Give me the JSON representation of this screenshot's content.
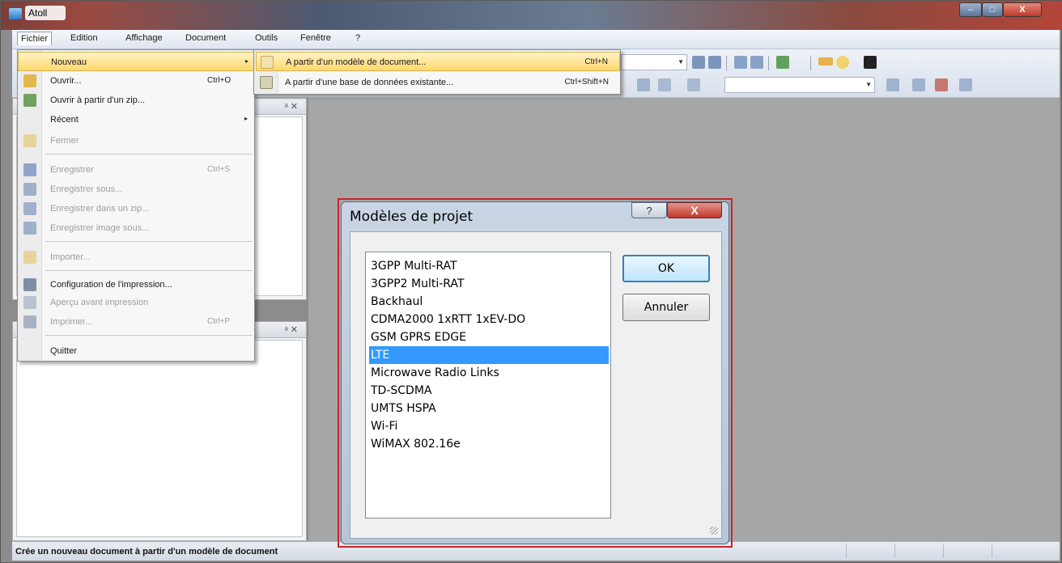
{
  "window": {
    "title": "Atoll",
    "controls": {
      "minimize": "–",
      "maximize": "□",
      "close": "X"
    }
  },
  "menubar": {
    "items": [
      "Fichier",
      "Edition",
      "Affichage",
      "Document",
      "Outils",
      "Fenêtre",
      "?"
    ]
  },
  "file_menu": {
    "items": [
      {
        "label": "Nouveau",
        "shortcut": "",
        "submenu": "▸",
        "icon": "new-document-icon"
      },
      {
        "label": "Ouvrir...",
        "shortcut": "Ctrl+O",
        "icon": "open-folder-icon"
      },
      {
        "label": "Ouvrir à partir d'un zip...",
        "shortcut": "",
        "icon": "open-zip-icon"
      },
      {
        "label": "Récent",
        "shortcut": "",
        "submenu": "▸",
        "icon": ""
      },
      {
        "label": "Fermer",
        "shortcut": "",
        "icon": "close-document-icon"
      },
      {
        "label": "Enregistrer",
        "shortcut": "Ctrl+S",
        "icon": "save-icon"
      },
      {
        "label": "Enregistrer sous...",
        "shortcut": "",
        "icon": "save-as-icon"
      },
      {
        "label": "Enregistrer dans un zip...",
        "shortcut": "",
        "icon": "save-zip-icon"
      },
      {
        "label": "Enregistrer image sous...",
        "shortcut": "",
        "icon": "save-image-icon"
      },
      {
        "label": "Importer...",
        "shortcut": "",
        "icon": "import-icon"
      },
      {
        "label": "Configuration de l'impression...",
        "shortcut": "",
        "icon": "print-setup-icon"
      },
      {
        "label": "Aperçu avant impression",
        "shortcut": "",
        "icon": "print-preview-icon"
      },
      {
        "label": "Imprimer...",
        "shortcut": "Ctrl+P",
        "icon": "print-icon"
      },
      {
        "label": "Quitter",
        "shortcut": "",
        "icon": ""
      }
    ]
  },
  "new_submenu": {
    "items": [
      {
        "label": "A partir d'un modèle de document...",
        "shortcut": "Ctrl+N",
        "icon": "template-icon"
      },
      {
        "label": "A partir d'une base de données existante...",
        "shortcut": "Ctrl+Shift+N",
        "icon": "database-icon"
      }
    ]
  },
  "panels": {
    "top_controls": "ᵃ ✕",
    "bottom_controls": "ᵃ ✕"
  },
  "dialog": {
    "title": "Modèles de projet",
    "help": "?",
    "close": "X",
    "templates": [
      "3GPP Multi-RAT",
      "3GPP2 Multi-RAT",
      "Backhaul",
      "CDMA2000 1xRTT 1xEV-DO",
      "GSM GPRS EDGE",
      "LTE",
      "Microwave Radio Links",
      "TD-SCDMA",
      "UMTS HSPA",
      "Wi-Fi",
      "WiMAX 802.16e"
    ],
    "selected": "LTE",
    "ok_label": "OK",
    "cancel_label": "Annuler"
  },
  "statusbar": {
    "text": "Crée un nouveau document à partir d'un modèle de document"
  },
  "colors": {
    "selection": "#3399ff",
    "menu_highlight": "#ffd86b",
    "dialog_outline": "#c6262e"
  }
}
